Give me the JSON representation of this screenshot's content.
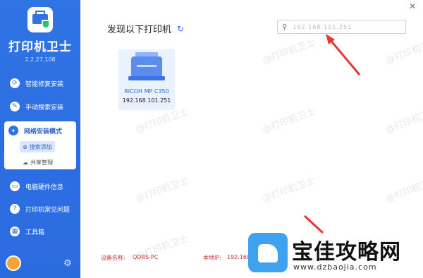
{
  "app": {
    "title": "打印机卫士",
    "version": "2.2.27.108"
  },
  "sidebar": {
    "items": [
      {
        "label": "智能修复安装"
      },
      {
        "label": "手动搜索安装"
      },
      {
        "label": "网络安装模式"
      },
      {
        "label": "电脑硬件信息"
      },
      {
        "label": "打印机常见问题"
      },
      {
        "label": "工具箱"
      }
    ],
    "subitems": [
      {
        "label": "搜索添加"
      },
      {
        "label": "共享管理"
      }
    ]
  },
  "main": {
    "heading": "发现以下打印机",
    "search": {
      "value": "192.168.101.251"
    },
    "printer": {
      "name": "RICOH MP C350",
      "ip": "192.168.101.251"
    },
    "footer": {
      "device_label": "设备名称:",
      "device_value": "QDRS-PC",
      "ip_label": "本地IP:",
      "ip_value": "192.168"
    }
  },
  "watermark_text": "@打印机卫士",
  "site_logo": {
    "name": "宝佳攻略网",
    "domain": "www.dzbaojia.com"
  },
  "colors": {
    "accent": "#2f73e4",
    "arrow": "#e53935",
    "footer_text": "#cc3333"
  }
}
